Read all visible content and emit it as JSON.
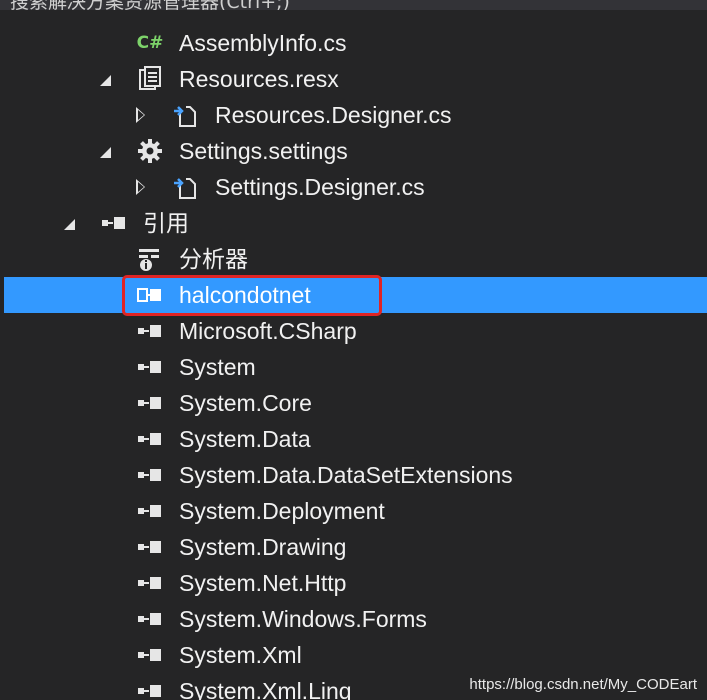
{
  "header": {
    "partial_title": "搜索解决方案资源管理器(Ctrl+;)"
  },
  "tree": {
    "assembly_info": "AssemblyInfo.cs",
    "resources_resx": "Resources.resx",
    "resources_designer": "Resources.Designer.cs",
    "settings_settings": "Settings.settings",
    "settings_designer": "Settings.Designer.cs",
    "references": "引用",
    "analyzers": "分析器",
    "ref_items": [
      "halcondotnet",
      "Microsoft.CSharp",
      "System",
      "System.Core",
      "System.Data",
      "System.Data.DataSetExtensions",
      "System.Deployment",
      "System.Drawing",
      "System.Net.Http",
      "System.Windows.Forms",
      "System.Xml",
      "System.Xml.Linq"
    ]
  },
  "icons": {
    "csharp_glyph": "C#",
    "expanded": "triangle-down-icon",
    "collapsed": "triangle-right-icon"
  },
  "colors": {
    "background": "#252526",
    "selection": "#3399ff",
    "highlight_box": "#e02424",
    "csharp_icon": "#7dd36a"
  },
  "watermark": "https://blog.csdn.net/My_CODEart"
}
